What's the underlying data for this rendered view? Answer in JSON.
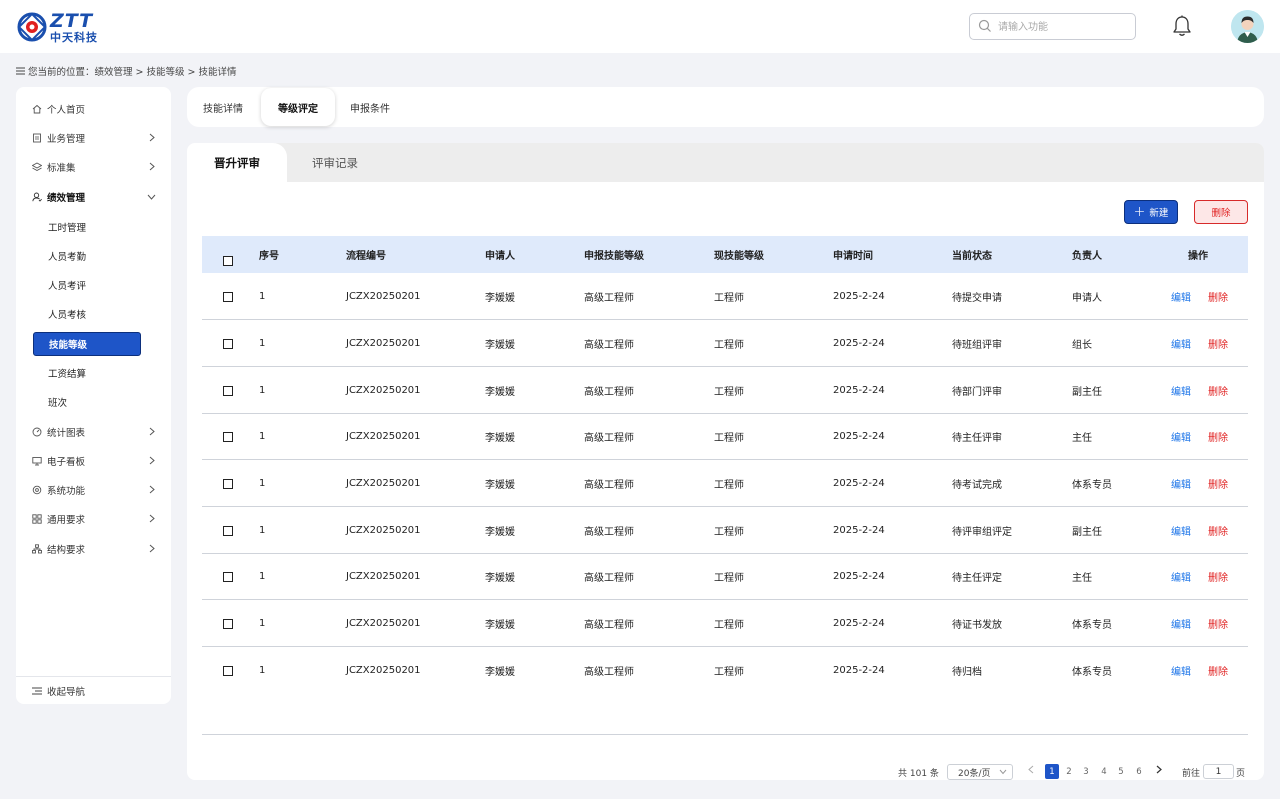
{
  "header": {
    "logo_en": "ZTT",
    "logo_cn": "中天科技",
    "search_placeholder": "请输入功能"
  },
  "breadcrumb": {
    "text": "您当前的位置：绩效管理 > 技能等级 > 技能详情"
  },
  "sidebar": {
    "items": [
      {
        "label": "个人首页"
      },
      {
        "label": "业务管理"
      },
      {
        "label": "标准集"
      },
      {
        "label": "绩效管理"
      },
      {
        "label": "统计图表"
      },
      {
        "label": "电子看板"
      },
      {
        "label": "系统功能"
      },
      {
        "label": "通用要求"
      },
      {
        "label": "结构要求"
      }
    ],
    "sub_items": [
      {
        "label": "工时管理"
      },
      {
        "label": "人员考勤"
      },
      {
        "label": "人员考评"
      },
      {
        "label": "人员考核"
      },
      {
        "label": "技能等级"
      },
      {
        "label": "工资结算"
      },
      {
        "label": "班次"
      }
    ],
    "footer": "收起导航"
  },
  "top_tabs": [
    {
      "label": "技能详情"
    },
    {
      "label": "等级评定"
    },
    {
      "label": "申报条件"
    }
  ],
  "panel_tabs": [
    {
      "label": "晋升评审"
    },
    {
      "label": "评审记录"
    }
  ],
  "toolbar": {
    "new_label": "新建",
    "delete_label": "删除"
  },
  "table": {
    "columns": [
      "序号",
      "流程编号",
      "申请人",
      "申报技能等级",
      "现技能等级",
      "申请时间",
      "当前状态",
      "负责人",
      "操作"
    ],
    "edit_label": "编辑",
    "delete_label": "删除",
    "rows": [
      {
        "no": "1",
        "code": "JCZX20250201",
        "applicant": "李媛媛",
        "apply_level": "高级工程师",
        "current_level": "工程师",
        "date": "2025-2-24",
        "status": "待提交申请",
        "owner": "申请人"
      },
      {
        "no": "1",
        "code": "JCZX20250201",
        "applicant": "李媛媛",
        "apply_level": "高级工程师",
        "current_level": "工程师",
        "date": "2025-2-24",
        "status": "待班组评审",
        "owner": "组长"
      },
      {
        "no": "1",
        "code": "JCZX20250201",
        "applicant": "李媛媛",
        "apply_level": "高级工程师",
        "current_level": "工程师",
        "date": "2025-2-24",
        "status": "待部门评审",
        "owner": "副主任"
      },
      {
        "no": "1",
        "code": "JCZX20250201",
        "applicant": "李媛媛",
        "apply_level": "高级工程师",
        "current_level": "工程师",
        "date": "2025-2-24",
        "status": "待主任评审",
        "owner": "主任"
      },
      {
        "no": "1",
        "code": "JCZX20250201",
        "applicant": "李媛媛",
        "apply_level": "高级工程师",
        "current_level": "工程师",
        "date": "2025-2-24",
        "status": "待考试完成",
        "owner": "体系专员"
      },
      {
        "no": "1",
        "code": "JCZX20250201",
        "applicant": "李媛媛",
        "apply_level": "高级工程师",
        "current_level": "工程师",
        "date": "2025-2-24",
        "status": "待评审组评定",
        "owner": "副主任"
      },
      {
        "no": "1",
        "code": "JCZX20250201",
        "applicant": "李媛媛",
        "apply_level": "高级工程师",
        "current_level": "工程师",
        "date": "2025-2-24",
        "status": "待主任评定",
        "owner": "主任"
      },
      {
        "no": "1",
        "code": "JCZX20250201",
        "applicant": "李媛媛",
        "apply_level": "高级工程师",
        "current_level": "工程师",
        "date": "2025-2-24",
        "status": "待证书发放",
        "owner": "体系专员"
      },
      {
        "no": "1",
        "code": "JCZX20250201",
        "applicant": "李媛媛",
        "apply_level": "高级工程师",
        "current_level": "工程师",
        "date": "2025-2-24",
        "status": "待归档",
        "owner": "体系专员"
      }
    ]
  },
  "pagination": {
    "total": "共 101 条",
    "page_size": "20条/页",
    "pages": [
      "1",
      "2",
      "3",
      "4",
      "5",
      "6"
    ],
    "current_page": "1",
    "goto_label": "前往",
    "goto_value": "1",
    "page_suffix": "页"
  },
  "colors": {
    "primary": "#1e55c8",
    "danger": "#e02020",
    "link": "#1a73e8",
    "header_bg": "#dfeafb",
    "page_bg": "#f2f3f7"
  },
  "icons": {
    "search": "search-icon",
    "bell": "bell-icon",
    "menu": "menu-icon",
    "chevron_right": "chevron-right-icon",
    "chevron_down": "chevron-down-icon",
    "plus": "plus-icon"
  }
}
